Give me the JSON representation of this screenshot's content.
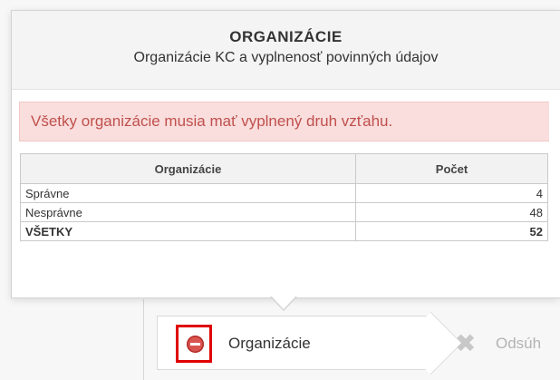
{
  "popup": {
    "title": "ORGANIZÁCIE",
    "subtitle": "Organizácie KC a vyplnenosť povinných údajov",
    "alert": "Všetky organizácie musia mať vyplnený druh vzťahu."
  },
  "table": {
    "headers": [
      "Organizácie",
      "Počet"
    ],
    "rows": [
      {
        "label": "Správne",
        "value": "4"
      },
      {
        "label": "Nesprávne",
        "value": "48"
      },
      {
        "label": "VŠETKY",
        "value": "52"
      }
    ]
  },
  "wizard": {
    "step1": {
      "label": "Organizácie",
      "icon": "stop-icon",
      "status_color": "#d9534f"
    },
    "step2": {
      "label": "Odsúh",
      "icon": "x-icon"
    }
  },
  "colors": {
    "alert_bg": "#f9dedd",
    "alert_text": "#c0504d",
    "highlight": "#e00000"
  }
}
